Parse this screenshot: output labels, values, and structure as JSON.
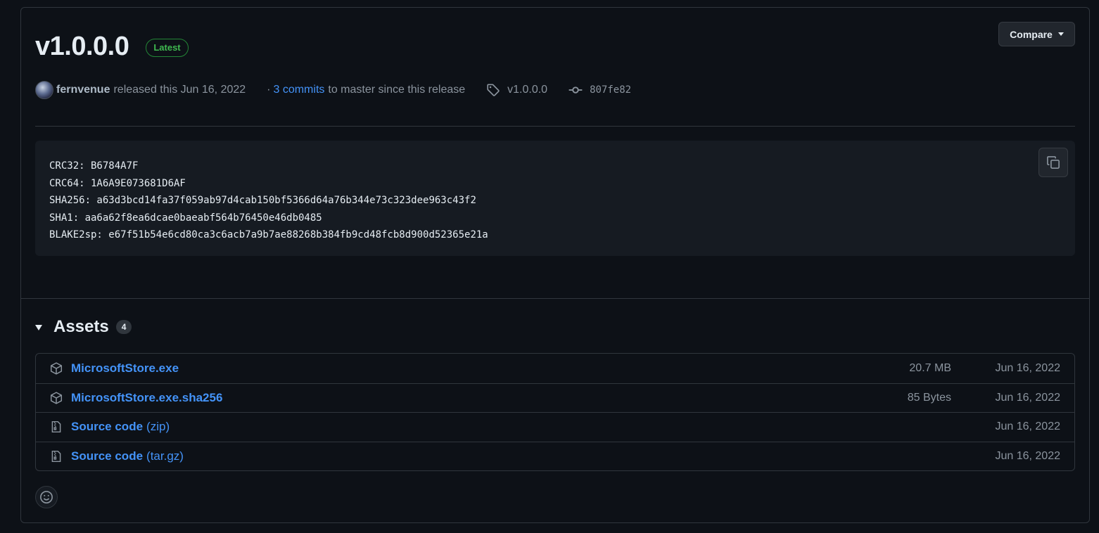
{
  "release": {
    "title": "v1.0.0.0",
    "badge": "Latest",
    "compare_label": "Compare",
    "author": "fernvenue",
    "released_text": "released this Jun 16, 2022",
    "dot": "·",
    "commits_link": "3 commits",
    "commits_suffix": "to master since this release",
    "tag": "v1.0.0.0",
    "commit_sha": "807fe82"
  },
  "hashes": [
    "CRC32: B6784A7F",
    "CRC64: 1A6A9E073681D6AF",
    "SHA256: a63d3bcd14fa37f059ab97d4cab150bf5366d64a76b344e73c323dee963c43f2",
    "SHA1: aa6a62f8ea6dcae0baeabf564b76450e46db0485",
    "BLAKE2sp: e67f51b54e6cd80ca3c6acb7a9b7ae88268b384fb9cd48fcb8d900d52365e21a"
  ],
  "assets": {
    "title": "Assets",
    "count": "4",
    "items": [
      {
        "name": "MicrosoftStore.exe",
        "suffix": "",
        "size": "20.7 MB",
        "date": "Jun 16, 2022",
        "icon": "package-icon"
      },
      {
        "name": "MicrosoftStore.exe.sha256",
        "suffix": "",
        "size": "85 Bytes",
        "date": "Jun 16, 2022",
        "icon": "package-icon"
      },
      {
        "name": "Source code",
        "suffix": "(zip)",
        "size": "",
        "date": "Jun 16, 2022",
        "icon": "file-zip-icon"
      },
      {
        "name": "Source code",
        "suffix": "(tar.gz)",
        "size": "",
        "date": "Jun 16, 2022",
        "icon": "file-zip-icon"
      }
    ]
  },
  "colors": {
    "background": "#0d1117",
    "border": "#30363d",
    "link": "#4493f8",
    "latest_green": "#3fb950",
    "muted": "#8b949e"
  }
}
